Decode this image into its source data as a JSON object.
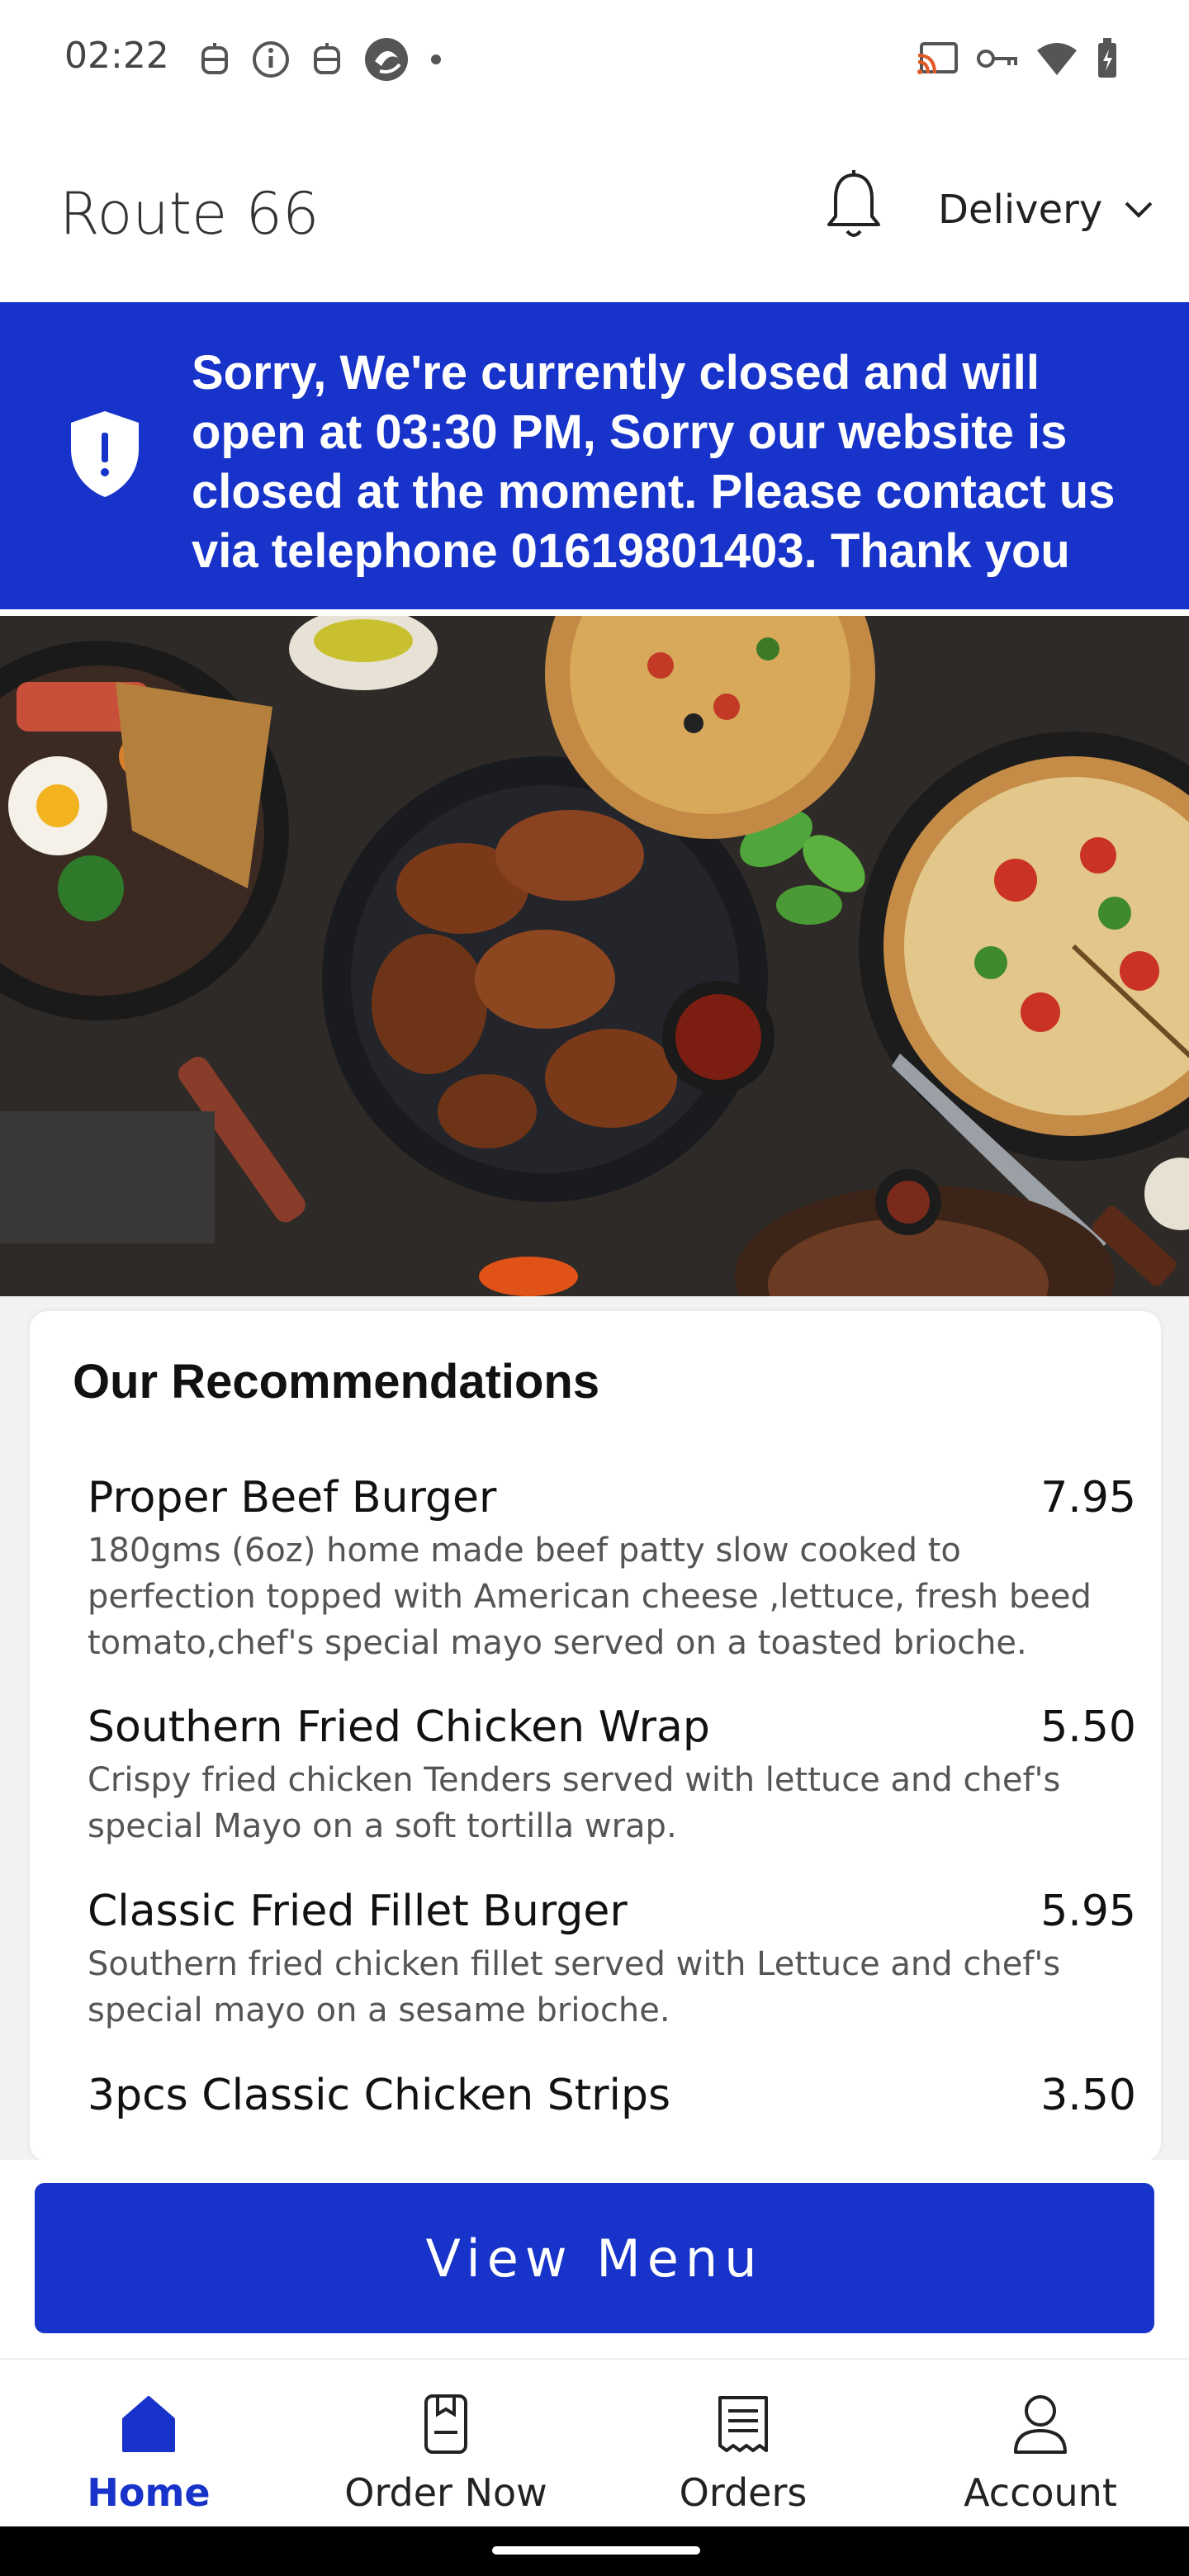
{
  "status_bar": {
    "time": "02:22",
    "left_icons": [
      "notification-bot-icon",
      "info-icon",
      "notification-bot-icon",
      "app-icon",
      "dot-icon"
    ],
    "right_icons": [
      "cast-icon",
      "vpn-key-icon",
      "wifi-icon",
      "battery-charging-icon"
    ]
  },
  "header": {
    "title": "Route 66",
    "delivery_mode": "Delivery"
  },
  "closed_banner": {
    "message": "Sorry, We're currently closed and will open at 03:30 PM, Sorry our website is closed at the moment. Please contact us via telephone 01619801403. Thank you"
  },
  "hero": {
    "image_icon": "food-banner-image"
  },
  "recommendations": {
    "title": "Our Recommendations",
    "items": [
      {
        "name": "Proper Beef Burger",
        "price": "7.95",
        "description": "180gms (6oz) home made beef patty slow cooked to perfection topped with American cheese ,lettuce, fresh beed tomato,chef's special mayo served on a toasted brioche."
      },
      {
        "name": "Southern Fried Chicken Wrap",
        "price": "5.50",
        "description": "Crispy fried chicken Tenders served with lettuce and chef's special Mayo on a soft tortilla wrap."
      },
      {
        "name": "Classic Fried Fillet Burger",
        "price": "5.95",
        "description": "Southern fried chicken fillet served with Lettuce and chef's special mayo on a sesame brioche."
      },
      {
        "name": "3pcs Classic Chicken Strips",
        "price": "3.50",
        "description": ""
      }
    ]
  },
  "cta": {
    "view_menu_label": "View Menu"
  },
  "bottom_nav": {
    "items": [
      {
        "label": "Home",
        "icon": "home-icon",
        "active": true
      },
      {
        "label": "Order Now",
        "icon": "order-now-icon",
        "active": false
      },
      {
        "label": "Orders",
        "icon": "receipt-icon",
        "active": false
      },
      {
        "label": "Account",
        "icon": "user-icon",
        "active": false
      }
    ]
  },
  "colors": {
    "brand_blue": "#1733c9",
    "text_dark": "#111111",
    "text_muted": "#555555"
  }
}
